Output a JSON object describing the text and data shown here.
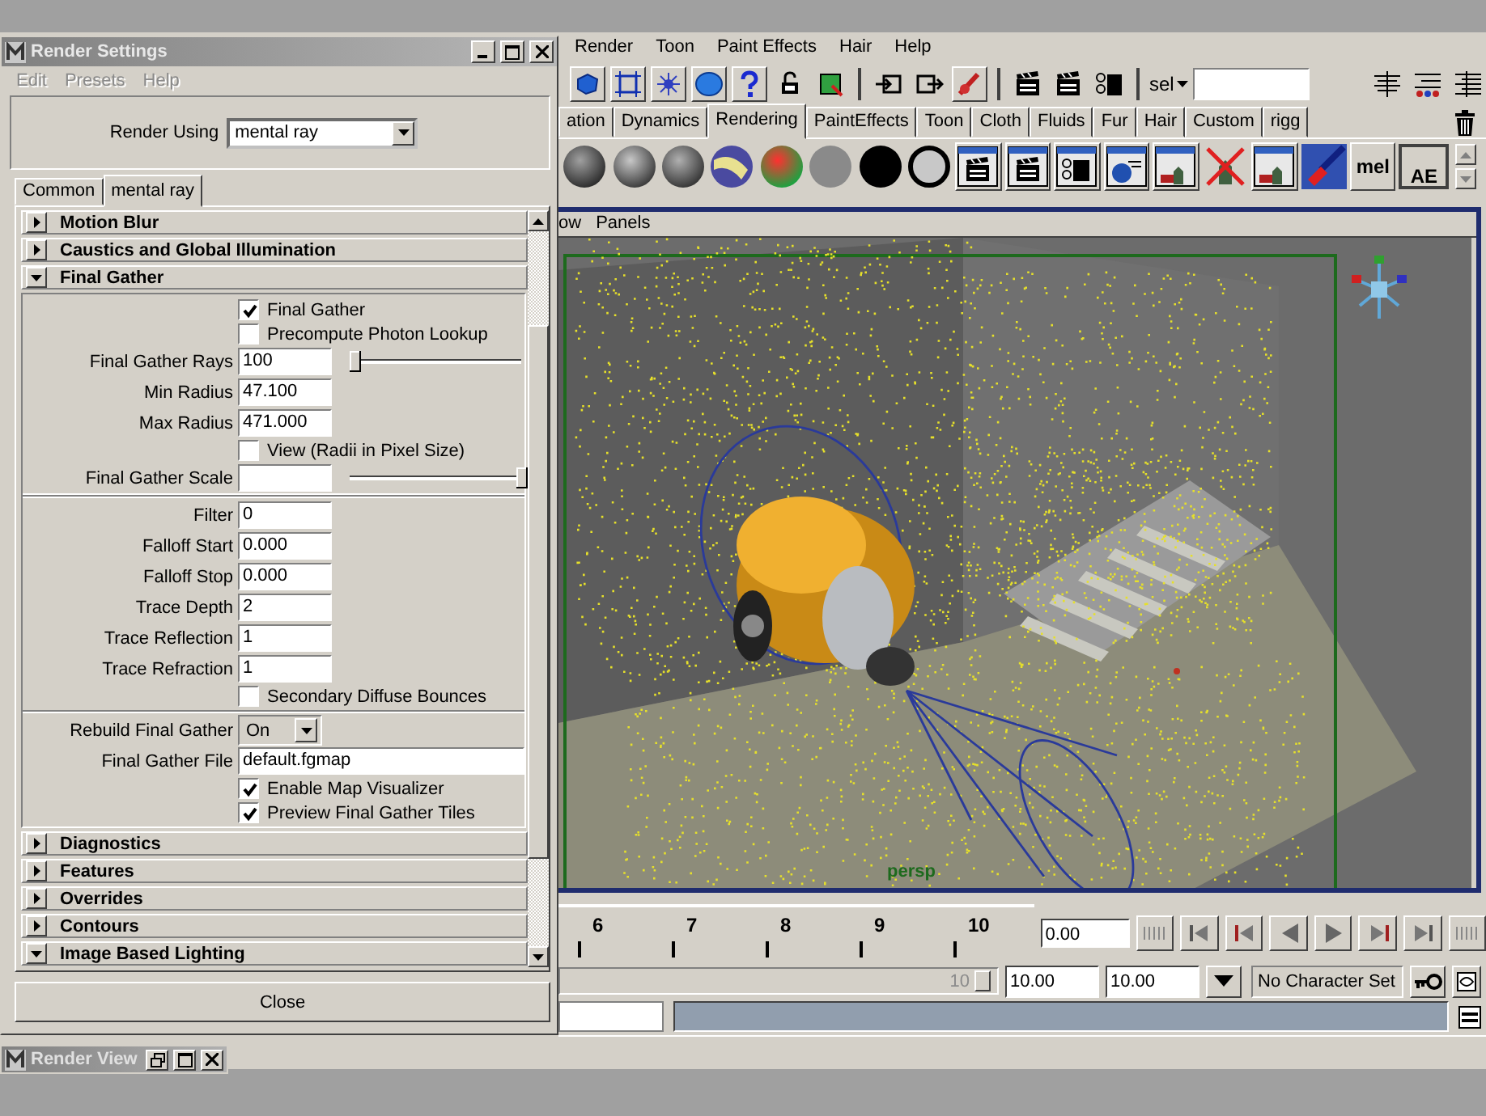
{
  "render_settings": {
    "title": "Render Settings",
    "menu": [
      "Edit",
      "Presets",
      "Help"
    ],
    "render_using": {
      "label": "Render Using",
      "value": "mental ray"
    },
    "tabs": [
      {
        "label": "Common",
        "selected": false
      },
      {
        "label": "mental ray",
        "selected": true
      }
    ],
    "sections": [
      {
        "title": "Motion Blur",
        "expanded": false
      },
      {
        "title": "Caustics and Global Illumination",
        "expanded": false
      },
      {
        "title": "Final Gather",
        "expanded": true,
        "groups": [
          [
            {
              "kind": "checkbox",
              "label": "Final Gather",
              "checked": true
            },
            {
              "kind": "checkbox",
              "label": "Precompute Photon Lookup",
              "checked": false
            },
            {
              "kind": "number_field",
              "label": "Final Gather Rays",
              "value": "100",
              "level": 0.03
            },
            {
              "kind": "number_field",
              "label": "Min Radius",
              "value": "47.100"
            },
            {
              "kind": "number_field",
              "label": "Max Radius",
              "value": "471.000"
            },
            {
              "kind": "checkbox",
              "label": "View (Radii in Pixel Size)",
              "checked": false
            },
            {
              "kind": "number_field",
              "label": "Final Gather Scale",
              "level": 1
            }
          ],
          [
            {
              "kind": "number_field",
              "label": "Filter",
              "value": "0"
            },
            {
              "kind": "number_field",
              "label": "Falloff Start",
              "value": "0.000"
            },
            {
              "kind": "number_field",
              "label": "Falloff Stop",
              "value": "0.000"
            },
            {
              "kind": "number_field",
              "label": "Trace Depth",
              "value": "2"
            },
            {
              "kind": "number_field",
              "label": "Trace Reflection",
              "value": "1"
            },
            {
              "kind": "number_field",
              "label": "Trace Refraction",
              "value": "1"
            },
            {
              "kind": "checkbox",
              "label": "Secondary Diffuse Bounces",
              "checked": false
            }
          ],
          [
            {
              "kind": "dropdown",
              "label": "Rebuild Final Gather",
              "value": "On"
            },
            {
              "kind": "text_field",
              "label": "Final Gather File",
              "value": "default.fgmap"
            },
            {
              "kind": "checkbox",
              "label": "Enable Map Visualizer",
              "checked": true
            },
            {
              "kind": "checkbox",
              "label": "Preview Final Gather Tiles",
              "checked": true
            }
          ]
        ]
      },
      {
        "title": "Diagnostics",
        "expanded": false
      },
      {
        "title": "Features",
        "expanded": false
      },
      {
        "title": "Overrides",
        "expanded": false
      },
      {
        "title": "Contours",
        "expanded": false
      },
      {
        "title": "Image Based Lighting",
        "expanded": true
      }
    ],
    "close_button": "Close"
  },
  "render_view": {
    "title": "Render View"
  },
  "main": {
    "menu": [
      "Render",
      "Toon",
      "Paint Effects",
      "Hair",
      "Help"
    ],
    "selection_label": "sel",
    "shelf_tabs": [
      {
        "label": "ation",
        "selected": false
      },
      {
        "label": "Dynamics",
        "selected": false
      },
      {
        "label": "Rendering",
        "selected": true
      },
      {
        "label": "PaintEffects",
        "selected": false
      },
      {
        "label": "Toon",
        "selected": false
      },
      {
        "label": "Cloth",
        "selected": false
      },
      {
        "label": "Fluids",
        "selected": false
      },
      {
        "label": "Fur",
        "selected": false
      },
      {
        "label": "Hair",
        "selected": false
      },
      {
        "label": "Custom",
        "selected": false
      },
      {
        "label": "rigg",
        "selected": false
      }
    ],
    "shelf_labels": [
      "mel",
      "AE"
    ],
    "panel_menu": [
      "ow",
      "Panels"
    ],
    "viewport": {
      "camera_label": "persp"
    },
    "timeline": {
      "ticks": [
        "6",
        "7",
        "8",
        "9",
        "10"
      ],
      "current_time": "0.00"
    },
    "range": {
      "end_marker": "10",
      "level": 1,
      "fields": [
        "10.00",
        "10.00"
      ],
      "character_set": "No Character Set"
    }
  }
}
